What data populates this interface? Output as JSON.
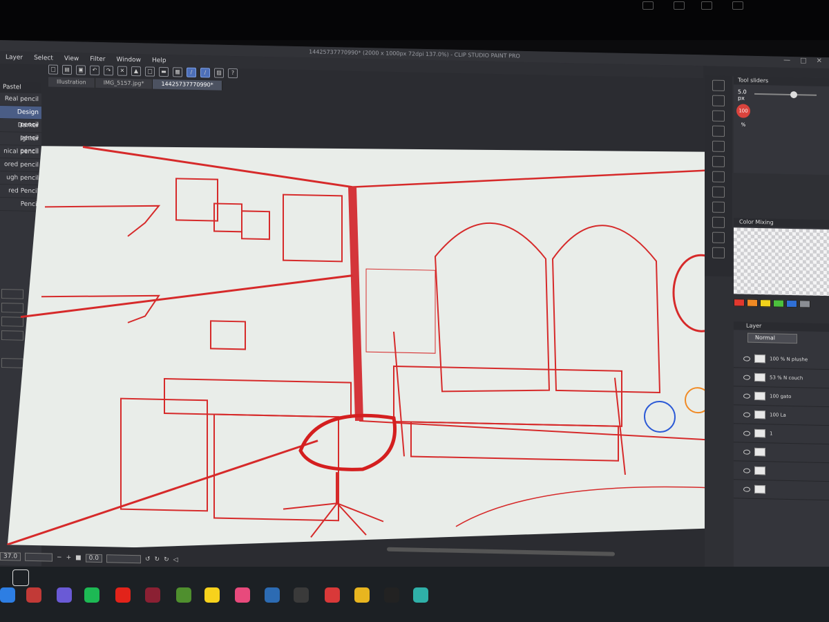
{
  "window": {
    "title": "14425737770990* (2000 x 1000px 72dpi 137.0%) - CLIP STUDIO PAINT PRO"
  },
  "menu": [
    "Layer",
    "Select",
    "View",
    "Filter",
    "Window",
    "Help"
  ],
  "tabs": [
    {
      "label": "Illustration",
      "active": false
    },
    {
      "label": "IMG_5157.jpg*",
      "active": false
    },
    {
      "label": "14425737770990*",
      "active": true
    }
  ],
  "brush_panel": {
    "title": "Pastel",
    "items": [
      {
        "label": "Real pencil",
        "selected": false
      },
      {
        "label": "Design pencil",
        "selected": true
      },
      {
        "label": "Darker pencil",
        "selected": false
      },
      {
        "label": "ighter pencil",
        "selected": false
      },
      {
        "label": "nical pencil",
        "selected": false
      },
      {
        "label": "ored pencil",
        "selected": false
      },
      {
        "label": "ugh pencil",
        "selected": false
      },
      {
        "label": "red Pencil",
        "selected": false
      },
      {
        "label": "Pencil",
        "selected": false
      }
    ]
  },
  "tool_sliders": {
    "title": "Tool sliders",
    "size_value": "5.0",
    "size_unit": "px",
    "opacity": "100 %"
  },
  "color_mixing": {
    "title": "Color Mixing"
  },
  "swatch_colors": [
    "#e2382e",
    "#f08a24",
    "#f2d21b",
    "#4cc13d",
    "#2f6fd6",
    "#8a8d93"
  ],
  "layer_panel": {
    "title": "Layer",
    "blend_mode": "Normal",
    "layers": [
      {
        "name": "100 % N plushe"
      },
      {
        "name": "53 % N couch"
      },
      {
        "name": "100 gato"
      },
      {
        "name": "100 La"
      },
      {
        "name": "1"
      },
      {
        "name": ""
      },
      {
        "name": ""
      },
      {
        "name": ""
      }
    ]
  },
  "navigator": {
    "zoom": "37.0",
    "rotation": "0.0"
  },
  "accent_color": "#d62a2a",
  "canvas_bg": "#e9ede9",
  "taskbar": {
    "icons": [
      {
        "name": "windows-start-icon",
        "color": "#2d7ee3"
      },
      {
        "name": "app-icon-red",
        "color": "#c23a37"
      },
      {
        "name": "app-icon-gradient",
        "color": "#6a5ad6"
      },
      {
        "name": "spotify-icon",
        "color": "#1db954"
      },
      {
        "name": "acrobat-icon",
        "color": "#e2231a"
      },
      {
        "name": "app-icon-m",
        "color": "#8b2033"
      },
      {
        "name": "minecraft-icon",
        "color": "#4f8f2e"
      },
      {
        "name": "sticky-notes-icon",
        "color": "#f7d21c"
      },
      {
        "name": "clip-studio-assets-icon",
        "color": "#e84a7c"
      },
      {
        "name": "vs-icon",
        "color": "#2c6bb3"
      },
      {
        "name": "obs-icon",
        "color": "#3a3a3a"
      },
      {
        "name": "creative-cloud-icon",
        "color": "#d93939"
      },
      {
        "name": "chrome-icon",
        "color": "#e8b51f"
      },
      {
        "name": "ua-icon",
        "color": "#222222"
      },
      {
        "name": "clip-studio-paint-icon",
        "color": "#2fb0a8"
      }
    ]
  }
}
